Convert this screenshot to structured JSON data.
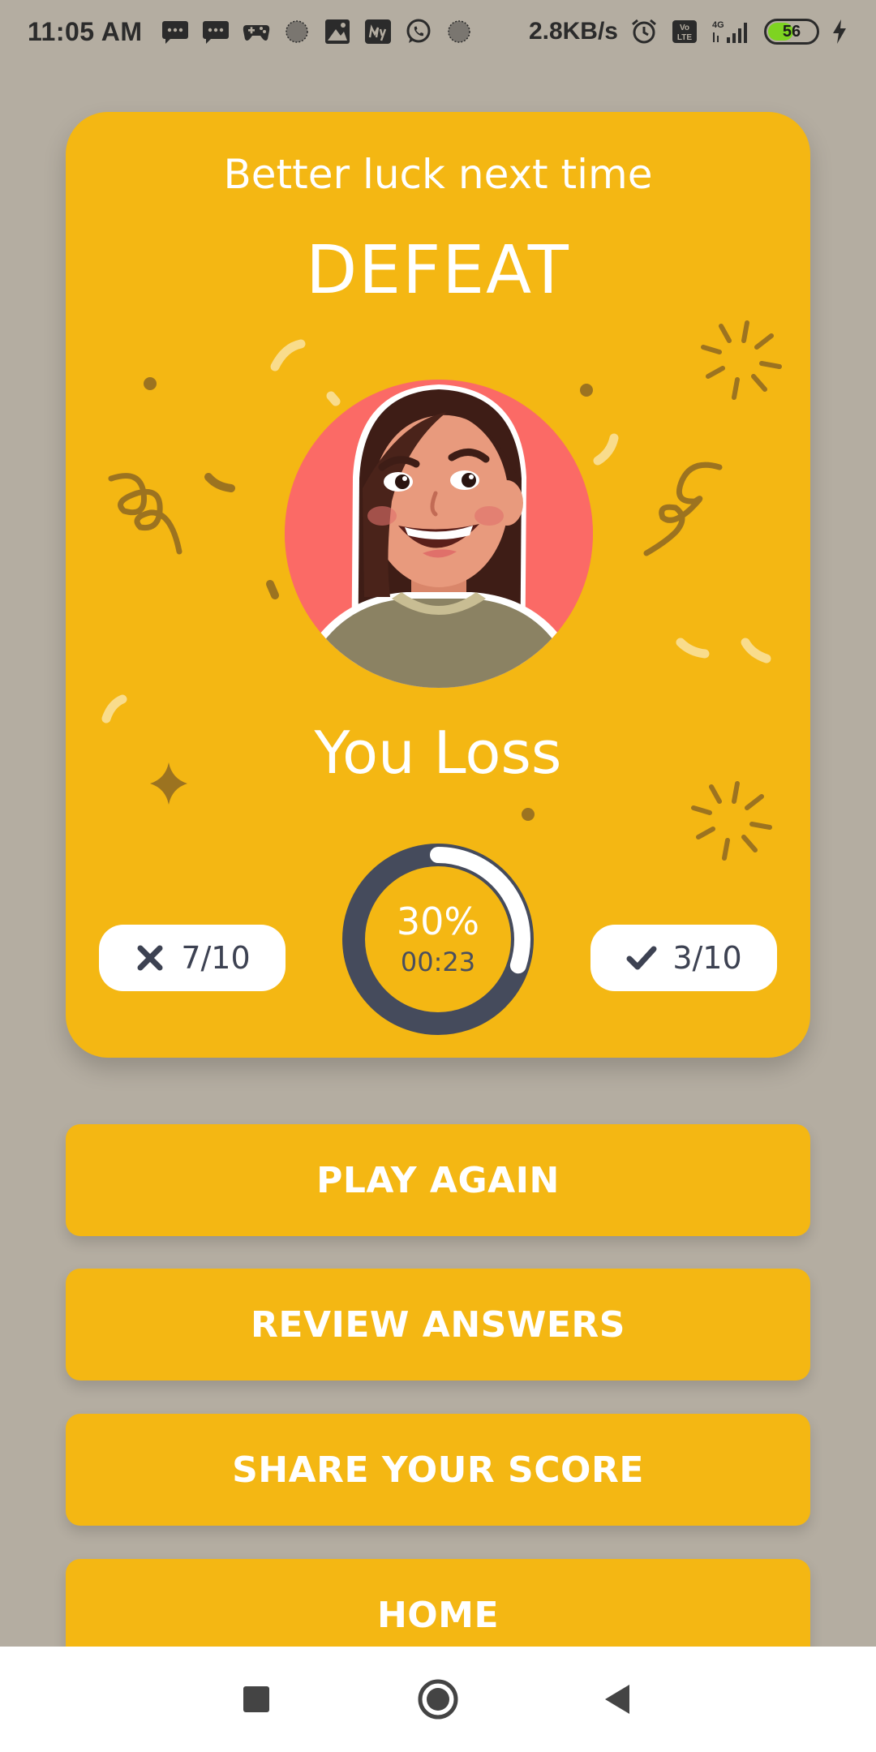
{
  "status_bar": {
    "time": "11:05 AM",
    "speed": "2.8KB/s",
    "battery_level": "56",
    "battery_fraction": 0.56,
    "notification_icons": [
      "message-icon",
      "message-icon",
      "game-controller-icon",
      "app-icon",
      "gallery-icon",
      "my-app-icon",
      "whatsapp-icon",
      "app-icon"
    ],
    "system_icons": [
      "alarm-icon",
      "volte-icon",
      "signal-4g-icon",
      "battery-icon",
      "charging-icon"
    ]
  },
  "card": {
    "subtitle": "Better luck next time",
    "title": "DEFEAT",
    "result_text": "You Loss",
    "wrong_count": "7/10",
    "correct_count": "3/10",
    "score_percent": "30%",
    "score_fraction": 0.3,
    "elapsed_time": "00:23",
    "colors": {
      "card": "#f4b713",
      "avatar_bg": "#fb6a66",
      "ring_track": "#454b5c",
      "ring_fill": "#ffffff"
    }
  },
  "buttons": {
    "play_again": "PLAY AGAIN",
    "review_answers": "REVIEW ANSWERS",
    "share_score": "SHARE YOUR SCORE",
    "home": "HOME"
  },
  "nav_bar": {
    "icons": [
      "recents-icon",
      "home-icon",
      "back-icon"
    ]
  }
}
